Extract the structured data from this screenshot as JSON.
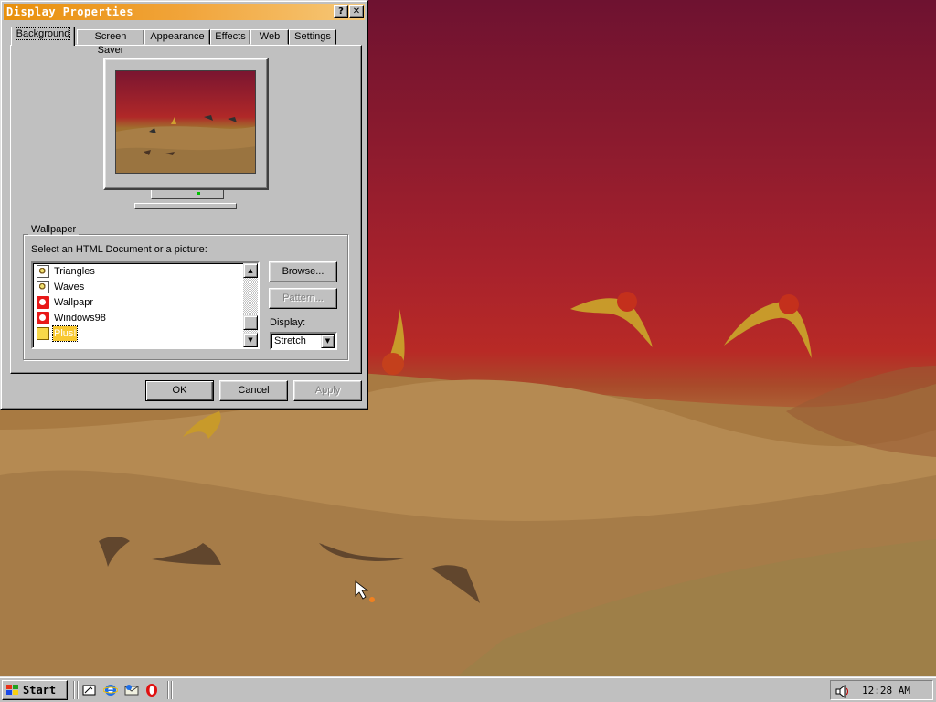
{
  "window": {
    "title": "Display Properties",
    "help_button": "?",
    "close_button": "✕"
  },
  "tabs": [
    {
      "label": "Background",
      "active": true
    },
    {
      "label": "Screen Saver",
      "active": false
    },
    {
      "label": "Appearance",
      "active": false
    },
    {
      "label": "Effects",
      "active": false
    },
    {
      "label": "Web",
      "active": false
    },
    {
      "label": "Settings",
      "active": false
    }
  ],
  "wallpaper": {
    "group_label": "Wallpaper",
    "prompt": "Select an HTML Document or a picture:",
    "items": [
      {
        "label": "Triangles",
        "icon": "html-document-icon"
      },
      {
        "label": "Waves",
        "icon": "html-document-icon"
      },
      {
        "label": "Wallpapr",
        "icon": "bitmap-icon"
      },
      {
        "label": "Windows98",
        "icon": "bitmap-icon"
      },
      {
        "label": "Plus!",
        "icon": "plus-theme-icon",
        "selected": true
      }
    ],
    "browse_label": "Browse...",
    "pattern_label": "Pattern...",
    "display_label": "Display:",
    "display_value": "Stretch"
  },
  "buttons": {
    "ok": "OK",
    "cancel": "Cancel",
    "apply": "Apply"
  },
  "taskbar": {
    "start_label": "Start",
    "quick_launch": [
      "show-desktop-icon",
      "internet-explorer-icon",
      "outlook-express-icon",
      "opera-icon"
    ],
    "tray_icon": "volume-icon",
    "clock": "12:28 AM"
  }
}
